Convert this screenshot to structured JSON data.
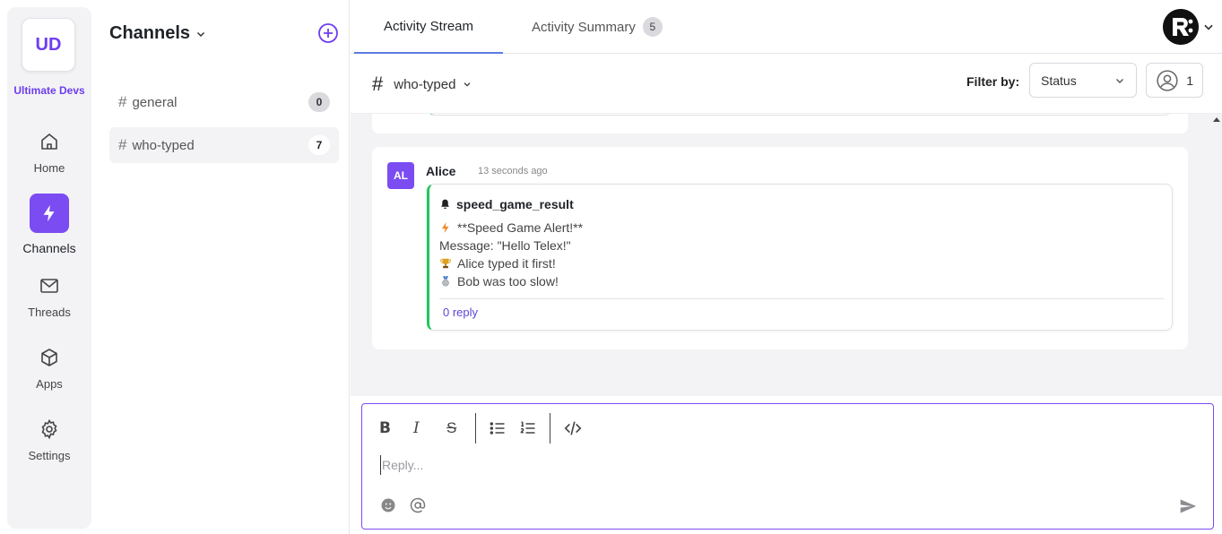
{
  "workspace": {
    "initials": "UD",
    "name": "Ultimate Devs"
  },
  "nav": {
    "home": "Home",
    "channels": "Channels",
    "threads": "Threads",
    "apps": "Apps",
    "settings": "Settings"
  },
  "channels_panel": {
    "title": "Channels",
    "items": [
      {
        "hash": "#",
        "name": "general",
        "count": "0",
        "active": false
      },
      {
        "hash": "#",
        "name": "who-typed",
        "count": "7",
        "active": true
      }
    ]
  },
  "tabs": [
    {
      "label": "Activity Stream",
      "active": true
    },
    {
      "label": "Activity Summary",
      "badge": "5",
      "active": false
    }
  ],
  "subbar": {
    "channel_hash": "#",
    "channel_name": "who-typed",
    "filter_label": "Filter by:",
    "filter_value": "Status",
    "members_count": "1"
  },
  "message": {
    "avatar": "AL",
    "author": "Alice",
    "time": "13 seconds ago",
    "attachment": {
      "title": "speed_game_result",
      "lines": [
        {
          "icon": "lightning-icon",
          "text": "**Speed Game Alert!**"
        },
        {
          "icon": "",
          "text": "Message: \"Hello Telex!\""
        },
        {
          "icon": "trophy-icon",
          "text": "Alice typed it first!"
        },
        {
          "icon": "medal-icon",
          "text": "Bob was too slow!"
        }
      ],
      "reply_link": "0 reply"
    }
  },
  "composer": {
    "placeholder": "Reply...",
    "toolbar": [
      "B",
      "I",
      "S"
    ]
  },
  "colors": {
    "accent": "#7b4cf2",
    "tab_underline": "#5b7be0",
    "attachment_border": "#22c55e",
    "link": "#5a48d8"
  }
}
